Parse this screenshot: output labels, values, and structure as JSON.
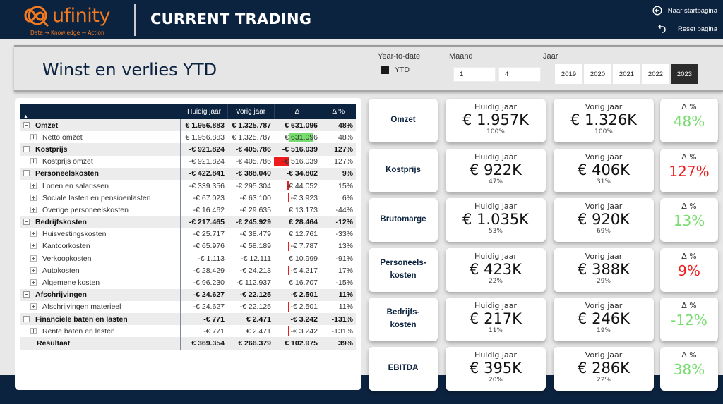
{
  "header": {
    "logo_text": "ufinity",
    "logo_tagline": "Data → Knowledge → Action",
    "title": "CURRENT TRADING",
    "nav_start": "Naar startpagina",
    "nav_reset": "Reset pagina"
  },
  "filters": {
    "page_title": "Winst en verlies YTD",
    "ytd_label": "Year-to-date",
    "ytd_option": "YTD",
    "month_label": "Maand",
    "month_from": "1",
    "month_to": "4",
    "year_label": "Jaar",
    "years": [
      "2019",
      "2020",
      "2021",
      "2022",
      "2023"
    ],
    "selected_year": "2023"
  },
  "matrix": {
    "sort_indicator": "▲",
    "columns": [
      "Huidig jaar",
      "Vorig jaar",
      "Δ",
      "Δ %"
    ],
    "rows": [
      {
        "type": "group",
        "label": "Omzet",
        "cy": "€ 1.956.883",
        "py": "€ 1.325.787",
        "delta": "€ 631.096",
        "pct": "48%"
      },
      {
        "type": "child",
        "label": "Netto omzet",
        "cy": "€ 1.956.883",
        "py": "€ 1.325.787",
        "delta": "€ 631.096",
        "pct": "48%",
        "bar": 631096
      },
      {
        "type": "group",
        "label": "Kostprijs",
        "cy": "-€ 921.824",
        "py": "-€ 405.786",
        "delta": "-€ 516.039",
        "pct": "127%"
      },
      {
        "type": "child",
        "label": "Kostprijs omzet",
        "cy": "-€ 921.824",
        "py": "-€ 405.786",
        "delta": "-€ 516.039",
        "pct": "127%",
        "bar": -516039
      },
      {
        "type": "group",
        "label": "Personeelskosten",
        "cy": "-€ 422.841",
        "py": "-€ 388.040",
        "delta": "-€ 34.802",
        "pct": "9%"
      },
      {
        "type": "child",
        "label": "Lonen en salarissen",
        "cy": "-€ 339.356",
        "py": "-€ 295.304",
        "delta": "-€ 44.052",
        "pct": "15%",
        "bar": -44052
      },
      {
        "type": "child",
        "label": "Sociale lasten en pensioenlasten",
        "cy": "-€ 67.023",
        "py": "-€ 63.100",
        "delta": "-€ 3.923",
        "pct": "6%",
        "bar": -3923
      },
      {
        "type": "child",
        "label": "Overige personeelskosten",
        "cy": "-€ 16.462",
        "py": "-€ 29.635",
        "delta": "€ 13.173",
        "pct": "-44%",
        "bar": 13173
      },
      {
        "type": "group",
        "label": "Bedrijfskosten",
        "cy": "-€ 217.465",
        "py": "-€ 245.929",
        "delta": "€ 28.464",
        "pct": "-12%"
      },
      {
        "type": "child",
        "label": "Huisvestingskosten",
        "cy": "-€ 25.717",
        "py": "-€ 38.479",
        "delta": "€ 12.761",
        "pct": "-33%",
        "bar": 12761
      },
      {
        "type": "child",
        "label": "Kantoorkosten",
        "cy": "-€ 65.976",
        "py": "-€ 58.189",
        "delta": "-€ 7.787",
        "pct": "13%",
        "bar": -7787
      },
      {
        "type": "child",
        "label": "Verkoopkosten",
        "cy": "-€ 1.113",
        "py": "-€ 12.111",
        "delta": "€ 10.999",
        "pct": "-91%",
        "bar": 10999
      },
      {
        "type": "child",
        "label": "Autokosten",
        "cy": "-€ 28.429",
        "py": "-€ 24.213",
        "delta": "-€ 4.217",
        "pct": "17%",
        "bar": -4217
      },
      {
        "type": "child",
        "label": "Algemene kosten",
        "cy": "-€ 96.230",
        "py": "-€ 112.937",
        "delta": "€ 16.707",
        "pct": "-15%",
        "bar": 16707
      },
      {
        "type": "group",
        "label": "Afschrijvingen",
        "cy": "-€ 24.627",
        "py": "-€ 22.125",
        "delta": "-€ 2.501",
        "pct": "11%"
      },
      {
        "type": "child",
        "label": "Afschrijvingen materieel",
        "cy": "-€ 24.627",
        "py": "-€ 22.125",
        "delta": "-€ 2.501",
        "pct": "11%",
        "bar": -2501
      },
      {
        "type": "group",
        "label": "Financiele baten en lasten",
        "cy": "-€ 771",
        "py": "€ 2.471",
        "delta": "-€ 3.242",
        "pct": "-131%"
      },
      {
        "type": "child",
        "label": "Rente baten en lasten",
        "cy": "-€ 771",
        "py": "€ 2.471",
        "delta": "-€ 3.242",
        "pct": "-131%",
        "bar": -3242
      },
      {
        "type": "total",
        "label": "Resultaat",
        "cy": "€ 369.354",
        "py": "€ 266.379",
        "delta": "€ 102.975",
        "pct": "39%"
      }
    ],
    "colors": {
      "positive": "#77dd6e",
      "negative": "#ee1c1c"
    }
  },
  "kpis": {
    "cy_caption": "Huidig jaar",
    "py_caption": "Vorig jaar",
    "pct_caption": "Δ %",
    "rows": [
      {
        "name": "Omzet",
        "cy": "€ 1.957K",
        "cy_share": "100%",
        "py": "€ 1.326K",
        "py_share": "100%",
        "delta_pct": "48%",
        "status": "pos"
      },
      {
        "name": "Kostprijs",
        "cy": "€ 922K",
        "cy_share": "47%",
        "py": "€ 406K",
        "py_share": "31%",
        "delta_pct": "127%",
        "status": "neg"
      },
      {
        "name": "Brutomarge",
        "cy": "€ 1.035K",
        "cy_share": "53%",
        "py": "€ 920K",
        "py_share": "69%",
        "delta_pct": "13%",
        "status": "pos"
      },
      {
        "name": "Personeels-\nkosten",
        "cy": "€ 423K",
        "cy_share": "22%",
        "py": "€ 388K",
        "py_share": "29%",
        "delta_pct": "9%",
        "status": "neg"
      },
      {
        "name": "Bedrijfs-\nkosten",
        "cy": "€ 217K",
        "cy_share": "11%",
        "py": "€ 246K",
        "py_share": "19%",
        "delta_pct": "-12%",
        "status": "pos"
      },
      {
        "name": "EBITDA",
        "cy": "€ 395K",
        "cy_share": "20%",
        "py": "€ 286K",
        "py_share": "22%",
        "delta_pct": "38%",
        "status": "pos"
      }
    ]
  }
}
